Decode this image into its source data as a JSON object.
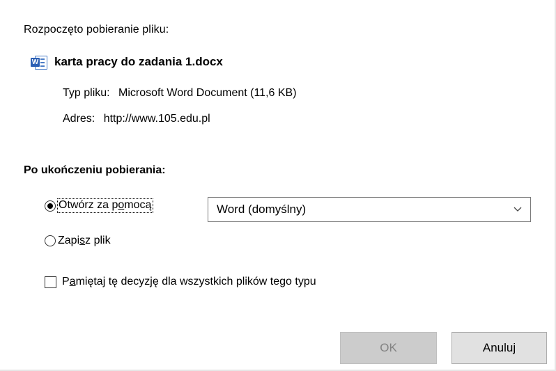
{
  "dialog": {
    "heading": "Rozpoczęto pobieranie pliku:",
    "file": {
      "name": "karta pracy do zadania 1.docx",
      "icon": "word-document-icon",
      "type_label": "Typ pliku:",
      "type_value": "Microsoft Word Document (11,6 KB)",
      "address_label": "Adres:",
      "address_value": "http://www.105.edu.pl"
    },
    "after_download": {
      "title": "Po ukończeniu pobierania:",
      "open_with": {
        "label_pre": "Otwórz za p",
        "label_accel": "o",
        "label_post": "mocą",
        "selected": true
      },
      "app_select": {
        "value": "Word (domyślny)"
      },
      "save_file": {
        "label_pre": "Zapi",
        "label_accel": "s",
        "label_post": "z plik",
        "selected": false
      },
      "remember": {
        "label_pre": "P",
        "label_accel": "a",
        "label_post": "miętaj tę decyzję dla wszystkich plików tego typu",
        "checked": false
      }
    },
    "buttons": {
      "ok": "OK",
      "cancel": "Anuluj"
    }
  }
}
